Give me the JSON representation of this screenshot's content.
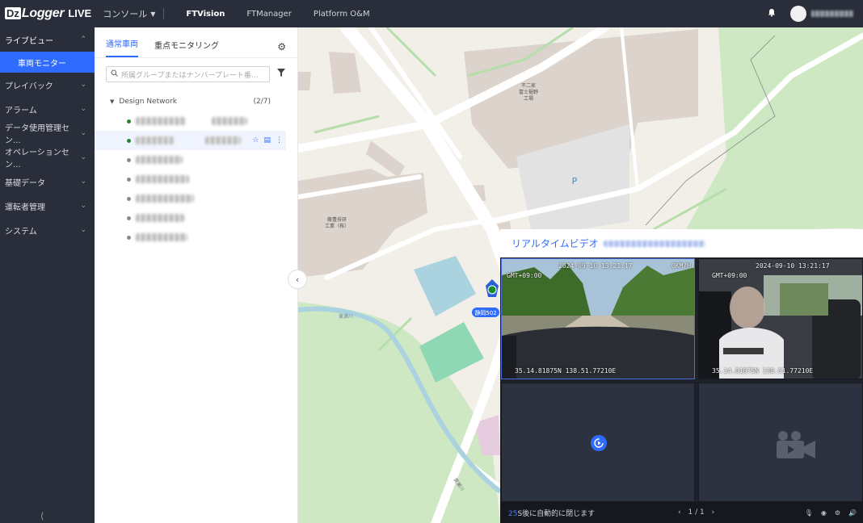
{
  "header": {
    "logo_dz": "Dz",
    "logo_text": "Logger",
    "logo_live": "LIVE",
    "console": "コンソール",
    "nav": [
      "FTVision",
      "FTManager",
      "Platform O&M"
    ],
    "active_nav": "FTVision"
  },
  "sidebar": {
    "items": [
      {
        "label": "ライブビュー",
        "open": true
      },
      {
        "label": "プレイバック"
      },
      {
        "label": "アラーム"
      },
      {
        "label": "データ使用管理セン..."
      },
      {
        "label": "オペレーションセン..."
      },
      {
        "label": "基礎データ"
      },
      {
        "label": "運転者管理"
      },
      {
        "label": "システム"
      }
    ],
    "sub_item": "車両モニター"
  },
  "panel": {
    "tabs": [
      "通常車両",
      "重点モニタリング"
    ],
    "search_placeholder": "所属グループまたはナンバープレート番...",
    "group": {
      "name": "Design Network",
      "count": "(2/7)"
    },
    "vehicles": [
      {
        "status": "online"
      },
      {
        "status": "online",
        "selected": true
      },
      {
        "status": "offline"
      },
      {
        "status": "offline"
      },
      {
        "status": "offline"
      },
      {
        "status": "offline"
      },
      {
        "status": "offline"
      }
    ]
  },
  "map": {
    "building_label_1": [
      "不二家",
      "富士裾野",
      "工場"
    ],
    "building_label_2": [
      "藤豊技研",
      "工業（株）"
    ],
    "parking": "P",
    "river_label": "黄瀬川",
    "vehicle_plate": "静岡502",
    "road_label": "黄瀬川"
  },
  "video": {
    "title": "リアルタイムビデオ",
    "cam1": {
      "time": "2024-09-10 13:21:17",
      "tz": "GMT+09:00",
      "speed": "0KM/H",
      "coords": "35.14.81875N 138.51.77210E"
    },
    "cam2": {
      "time": "2024-09-10 13:21:17",
      "tz": "GMT+09:00",
      "coords": "35.14.81875N 138.51.77210E"
    },
    "countdown_num": "25",
    "countdown_text": "S後に自動的に閉じます",
    "page": "1 / 1"
  },
  "colors": {
    "accent": "#2f6bff",
    "sidebar": "#2a2e3a",
    "online": "#1a8a2a"
  }
}
